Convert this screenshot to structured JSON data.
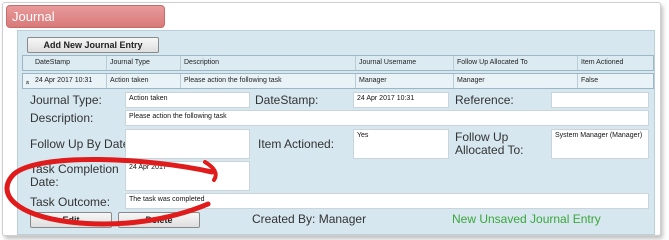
{
  "tab": {
    "title": "Journal"
  },
  "toolbar": {
    "add_label": "Add New Journal Entry"
  },
  "grid": {
    "headers": [
      "DateStamp",
      "Journal Type",
      "Description",
      "Journal Username",
      "Follow Up Allocated To",
      "Item Actioned"
    ],
    "row": {
      "expander": "»",
      "cells": [
        "24 Apr 2017 10:31",
        "Action taken",
        "Please action the following task",
        "Manager",
        "Manager",
        "False"
      ]
    }
  },
  "detail": {
    "journal_type": {
      "label": "Journal Type:",
      "value": "Action taken"
    },
    "datestamp": {
      "label": "DateStamp:",
      "value": "24 Apr 2017 10:31"
    },
    "reference": {
      "label": "Reference:",
      "value": ""
    },
    "description": {
      "label": "Description:",
      "value": "Please action the following task"
    },
    "follow_up_by_date": {
      "label": "Follow Up By Date:",
      "value": ""
    },
    "item_actioned": {
      "label": "Item Actioned:",
      "value": "Yes"
    },
    "follow_up_allocated": {
      "label": "Follow Up Allocated To:",
      "value": "System Manager (Manager)"
    },
    "task_completion_date": {
      "label": "Task Completion Date:",
      "value": "24 Apr 2017"
    },
    "task_outcome": {
      "label": "Task Outcome:",
      "value": "The task was completed"
    }
  },
  "footer": {
    "edit_label": "Edit",
    "delete_label": "Delete",
    "created_by": "Created By: Manager",
    "status": "New Unsaved Journal Entry"
  },
  "colors": {
    "tab": "#d97a7a",
    "panel": "#d6e7ef",
    "status": "#3aa63a",
    "annotation": "#e01b1b"
  }
}
